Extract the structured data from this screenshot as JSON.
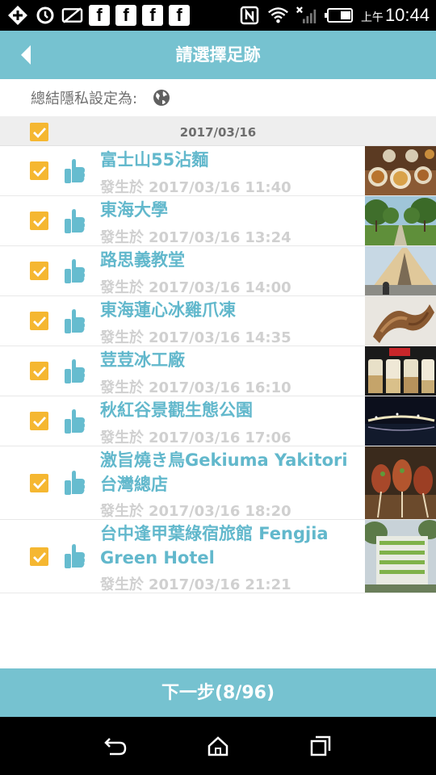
{
  "status_bar": {
    "time_prefix": "上午",
    "time": "10:44",
    "icons": [
      "add-icon",
      "sync-icon",
      "disabled-notification-icon",
      "facebook-icon",
      "facebook-icon",
      "facebook-icon",
      "facebook-icon",
      "nfc-icon",
      "wifi-icon",
      "signal-icon",
      "battery-icon"
    ]
  },
  "header": {
    "title": "請選擇足跡",
    "back_icon": "back-arrow-icon"
  },
  "privacy": {
    "label": "總結隱私設定為:",
    "icon": "globe-icon"
  },
  "date_group": {
    "date": "2017/03/16",
    "checked": true
  },
  "items": [
    {
      "title": "富士山55沾麵",
      "prefix": "發生於",
      "date": "2017/03/16",
      "time": "11:40",
      "checked": true,
      "photo": "ramen-food-photo"
    },
    {
      "title": "東海大學",
      "prefix": "發生於",
      "date": "2017/03/16",
      "time": "13:24",
      "checked": true,
      "photo": "university-trees-photo"
    },
    {
      "title": "路思義教堂",
      "prefix": "發生於",
      "date": "2017/03/16",
      "time": "14:00",
      "checked": true,
      "photo": "chapel-photo"
    },
    {
      "title": "東海蓮心冰雞爪凍",
      "prefix": "發生於",
      "date": "2017/03/16",
      "time": "14:35",
      "checked": true,
      "photo": "chicken-feet-photo"
    },
    {
      "title": "荳荳冰工廠",
      "prefix": "發生於",
      "date": "2017/03/16",
      "time": "16:10",
      "checked": true,
      "photo": "drinks-photo"
    },
    {
      "title": "秋紅谷景觀生態公園",
      "prefix": "發生於",
      "date": "2017/03/16",
      "time": "17:06",
      "checked": true,
      "photo": "night-park-photo"
    },
    {
      "title": "激旨燒き鳥Gekiuma Yakitori台灣總店",
      "prefix": "發生於",
      "date": "2017/03/16",
      "time": "18:20",
      "checked": true,
      "photo": "yakitori-photo"
    },
    {
      "title": "台中逢甲葉綠宿旅館 Fengjia Green Hotel",
      "prefix": "發生於",
      "date": "2017/03/16",
      "time": "21:21",
      "checked": true,
      "photo": "hotel-photo"
    }
  ],
  "next_button": {
    "label": "下一步(8/96)"
  },
  "colors": {
    "accent": "#76c2d0",
    "title_text": "#62b8cc",
    "checkbox": "#f5b731",
    "time_text": "#d0d0d0"
  }
}
